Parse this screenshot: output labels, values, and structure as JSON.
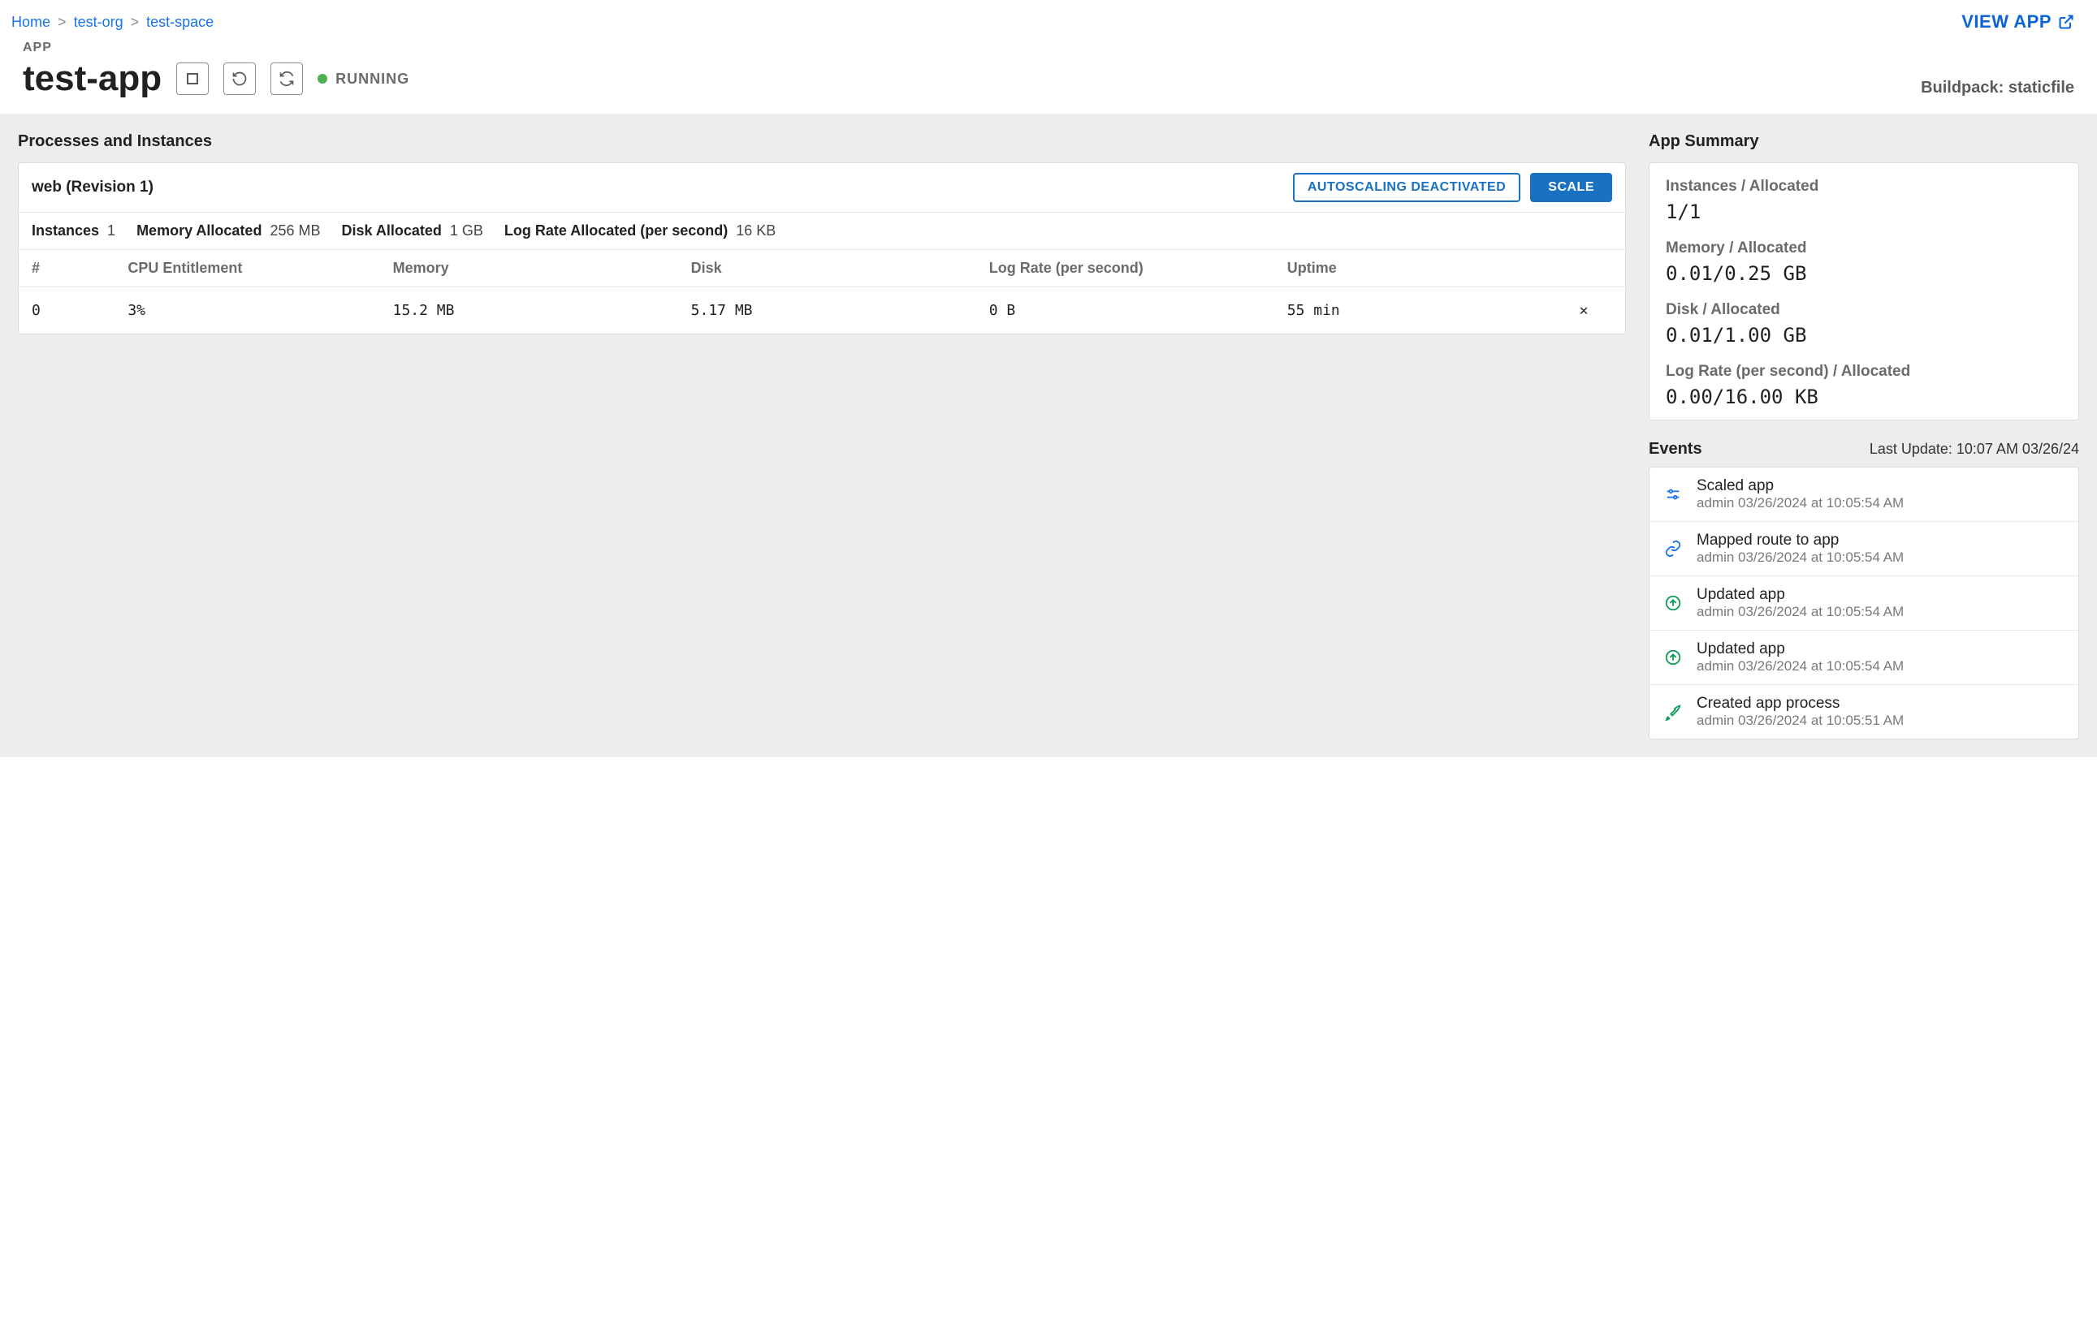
{
  "breadcrumb": {
    "home": "Home",
    "org": "test-org",
    "space": "test-space"
  },
  "view_app_label": "VIEW APP",
  "header": {
    "app_label": "APP",
    "app_name": "test-app",
    "status": "RUNNING",
    "buildpack_label": "Buildpack: staticfile"
  },
  "processes": {
    "section_title": "Processes and Instances",
    "title": "web (Revision 1)",
    "autoscaling_btn": "AUTOSCALING DEACTIVATED",
    "scale_btn": "SCALE",
    "alloc": {
      "instances_lbl": "Instances",
      "instances_val": "1",
      "memory_lbl": "Memory Allocated",
      "memory_val": "256 MB",
      "disk_lbl": "Disk Allocated",
      "disk_val": "1 GB",
      "lograte_lbl": "Log Rate Allocated (per second)",
      "lograte_val": "16 KB"
    },
    "cols": {
      "idx": "#",
      "cpu": "CPU Entitlement",
      "memory": "Memory",
      "disk": "Disk",
      "lograte": "Log Rate (per second)",
      "uptime": "Uptime"
    },
    "rows": [
      {
        "idx": "0",
        "cpu": "3%",
        "memory": "15.2 MB",
        "disk": "5.17 MB",
        "lograte": "0 B",
        "uptime": "55 min"
      }
    ]
  },
  "summary": {
    "section_title": "App Summary",
    "instances_lbl": "Instances / Allocated",
    "instances_val": "1/1",
    "memory_lbl": "Memory / Allocated",
    "memory_val": "0.01/0.25 GB",
    "disk_lbl": "Disk / Allocated",
    "disk_val": "0.01/1.00 GB",
    "lograte_lbl": "Log Rate (per second) / Allocated",
    "lograte_val": "0.00/16.00 KB"
  },
  "events": {
    "section_title": "Events",
    "last_update": "Last Update: 10:07 AM 03/26/24",
    "items": [
      {
        "icon": "sliders",
        "title": "Scaled app",
        "meta": "admin 03/26/2024 at 10:05:54 AM"
      },
      {
        "icon": "link",
        "title": "Mapped route to app",
        "meta": "admin 03/26/2024 at 10:05:54 AM"
      },
      {
        "icon": "up",
        "title": "Updated app",
        "meta": "admin 03/26/2024 at 10:05:54 AM"
      },
      {
        "icon": "up",
        "title": "Updated app",
        "meta": "admin 03/26/2024 at 10:05:54 AM"
      },
      {
        "icon": "rocket",
        "title": "Created app process",
        "meta": "admin 03/26/2024 at 10:05:51 AM"
      }
    ]
  }
}
